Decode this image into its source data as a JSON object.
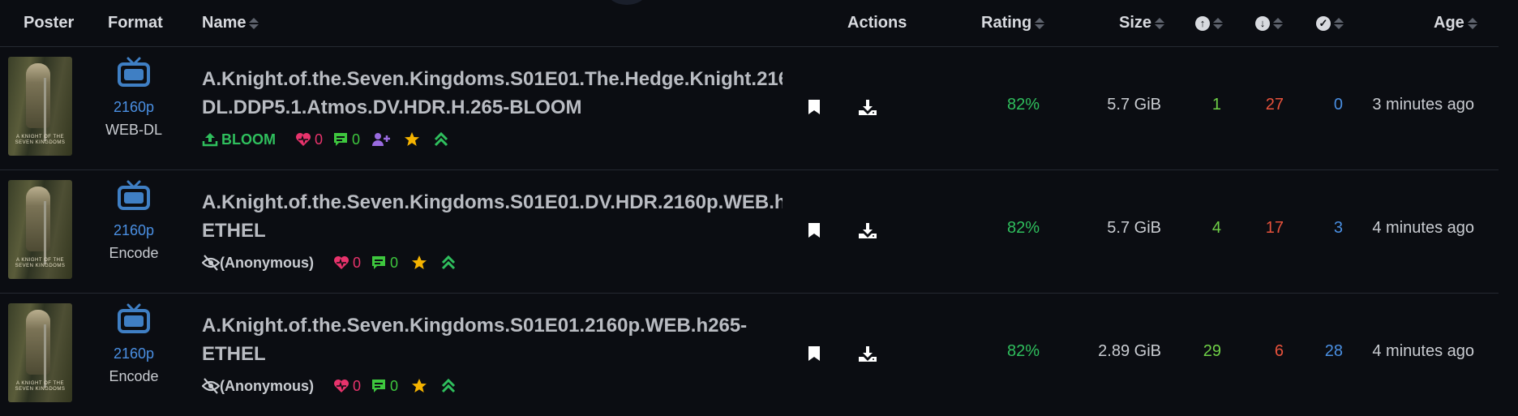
{
  "columns": {
    "poster": "Poster",
    "format": "Format",
    "name": "Name",
    "actions": "Actions",
    "rating": "Rating",
    "size": "Size",
    "seeders_icon": "arrow-up-circle-icon",
    "leechers_icon": "arrow-down-circle-icon",
    "completed_icon": "check-circle-icon",
    "age": "Age"
  },
  "rows": [
    {
      "poster_text": "A KNIGHT OF THE SEVEN KINGDOMS",
      "resolution": "2160p",
      "type": "WEB-DL",
      "name_line1": "A.Knight.of.the.Seven.Kingdoms.S01E01.The.Hedge.Knight.216",
      "name_line2": "DL.DDP5.1.Atmos.DV.HDR.H.265-BLOOM",
      "uploader": "BLOOM",
      "thanks": "0",
      "comments": "0",
      "rating": "82%",
      "size": "5.7 GiB",
      "seeders": "1",
      "leechers": "27",
      "completed": "0",
      "age": "3 minutes ago"
    },
    {
      "poster_text": "A KNIGHT OF THE SEVEN KINGDOMS",
      "resolution": "2160p",
      "type": "Encode",
      "name_line1": "A.Knight.of.the.Seven.Kingdoms.S01E01.DV.HDR.2160p.WEB.h",
      "name_line2": "ETHEL",
      "uploader": "(Anonymous)",
      "thanks": "0",
      "comments": "0",
      "rating": "82%",
      "size": "5.7 GiB",
      "seeders": "4",
      "leechers": "17",
      "completed": "3",
      "age": "4 minutes ago"
    },
    {
      "poster_text": "A KNIGHT OF THE SEVEN KINGDOMS",
      "resolution": "2160p",
      "type": "Encode",
      "name_line1": "A.Knight.of.the.Seven.Kingdoms.S01E01.2160p.WEB.h265-",
      "name_line2": "ETHEL",
      "uploader": "(Anonymous)",
      "thanks": "0",
      "comments": "0",
      "rating": "82%",
      "size": "2.89 GiB",
      "seeders": "29",
      "leechers": "6",
      "completed": "28",
      "age": "4 minutes ago"
    }
  ],
  "colors": {
    "background": "#0b0d12",
    "rating": "#2fbf5d",
    "seeders": "#6fcf47",
    "leechers": "#e8523c",
    "completed": "#4a8fe2",
    "resolution": "#4a8fe2",
    "thanks": "#e8336c",
    "comments": "#3ec73e",
    "featured_star": "#f5b300"
  }
}
